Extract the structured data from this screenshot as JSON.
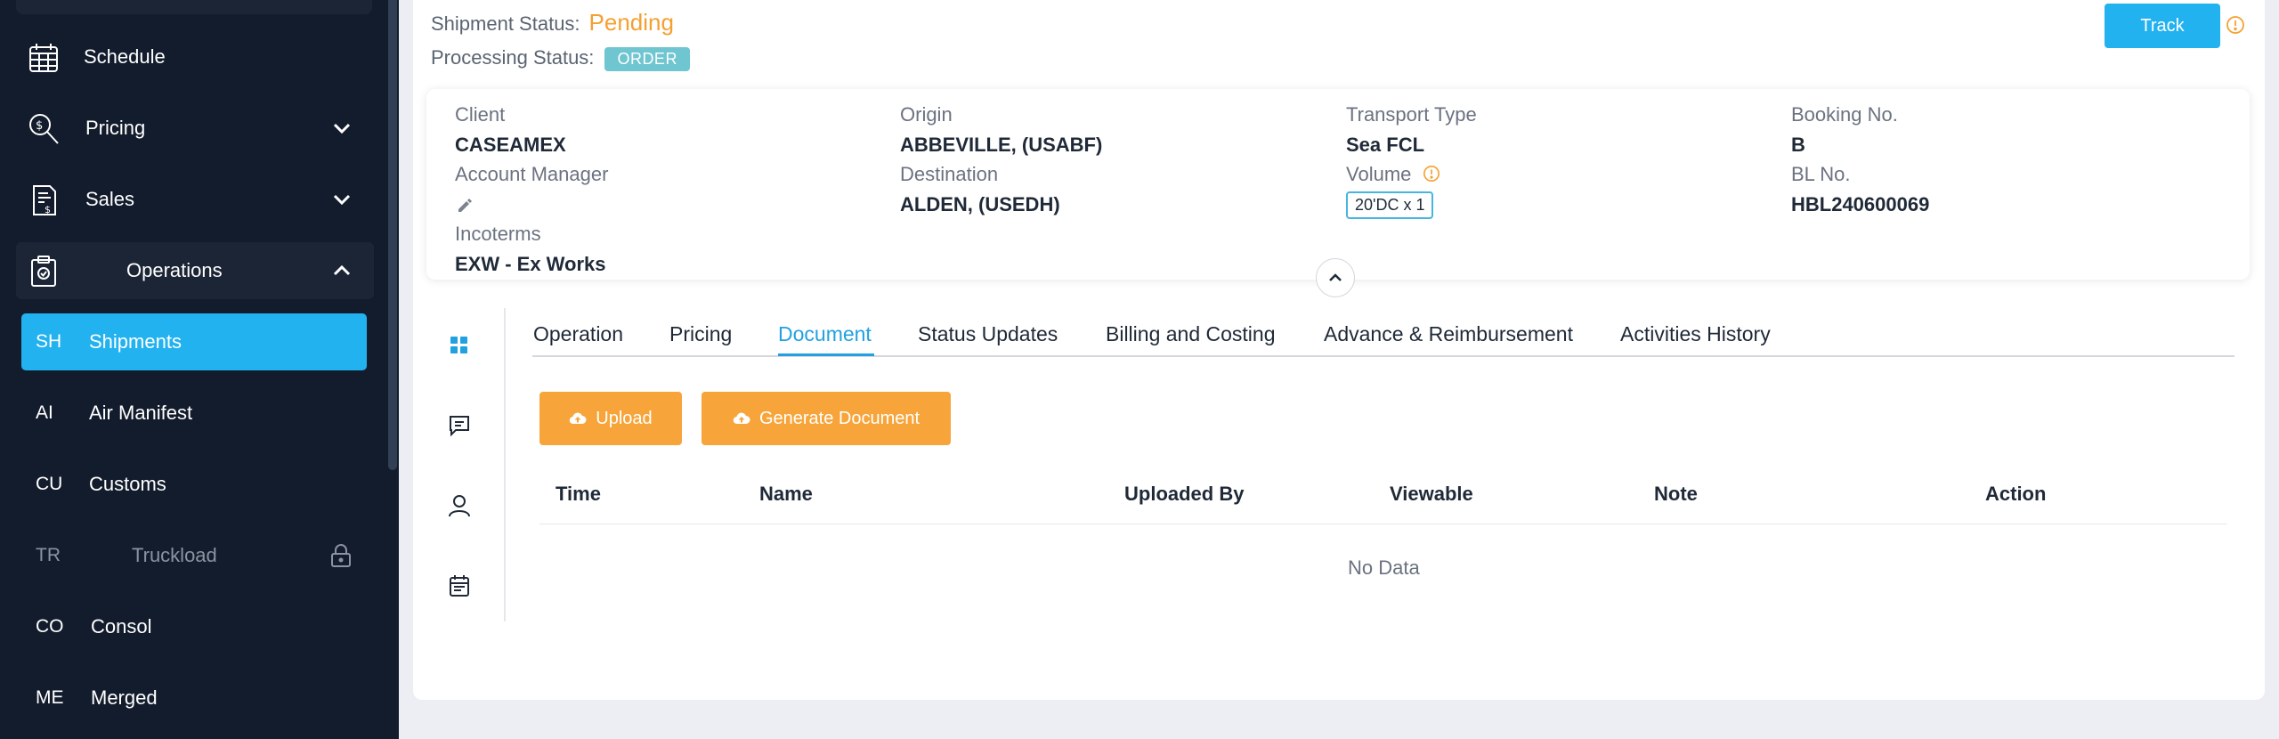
{
  "sidebar": {
    "items": [
      {
        "label": "Schedule",
        "icon": "calendar-icon"
      },
      {
        "label": "Pricing",
        "icon": "pricing-search-icon"
      },
      {
        "label": "Sales",
        "icon": "sales-doc-icon"
      },
      {
        "label": "Operations",
        "icon": "clipboard-icon"
      }
    ],
    "sub_items": [
      {
        "abbr": "SH",
        "label": "Shipments"
      },
      {
        "abbr": "AI",
        "label": "Air Manifest"
      },
      {
        "abbr": "CU",
        "label": "Customs"
      },
      {
        "abbr": "TR",
        "label": "Truckload"
      },
      {
        "abbr": "CO",
        "label": "Consol"
      },
      {
        "abbr": "ME",
        "label": "Merged"
      }
    ]
  },
  "header": {
    "shipment_status_label": "Shipment Status:",
    "shipment_status_value": "Pending",
    "processing_status_label": "Processing Status:",
    "processing_status_value": "ORDER",
    "track_label": "Track"
  },
  "info": {
    "client_label": "Client",
    "client_value": "CASEAMEX",
    "account_manager_label": "Account Manager",
    "incoterms_label": "Incoterms",
    "incoterms_value": "EXW - Ex Works",
    "origin_label": "Origin",
    "origin_value": "ABBEVILLE, (USABF)",
    "destination_label": "Destination",
    "destination_value": "ALDEN, (USEDH)",
    "transport_type_label": "Transport Type",
    "transport_type_value": "Sea FCL",
    "volume_label": "Volume",
    "volume_value": "20'DC x 1",
    "booking_no_label": "Booking No.",
    "booking_no_value": "B",
    "bl_no_label": "BL No.",
    "bl_no_value": "HBL240600069"
  },
  "tabs": [
    {
      "label": "Operation"
    },
    {
      "label": "Pricing"
    },
    {
      "label": "Document"
    },
    {
      "label": "Status Updates"
    },
    {
      "label": "Billing and Costing"
    },
    {
      "label": "Advance & Reimbursement"
    },
    {
      "label": "Activities History"
    }
  ],
  "actions": {
    "upload_label": "Upload",
    "generate_label": "Generate Document"
  },
  "table": {
    "columns": [
      "Time",
      "Name",
      "Uploaded By",
      "Viewable",
      "Note",
      "Action"
    ],
    "empty_text": "No Data"
  },
  "colors": {
    "accent": "#22b2ef",
    "pending": "#f5a031",
    "orange_button": "#f7a53a",
    "sidebar_bg": "#131c2c"
  }
}
